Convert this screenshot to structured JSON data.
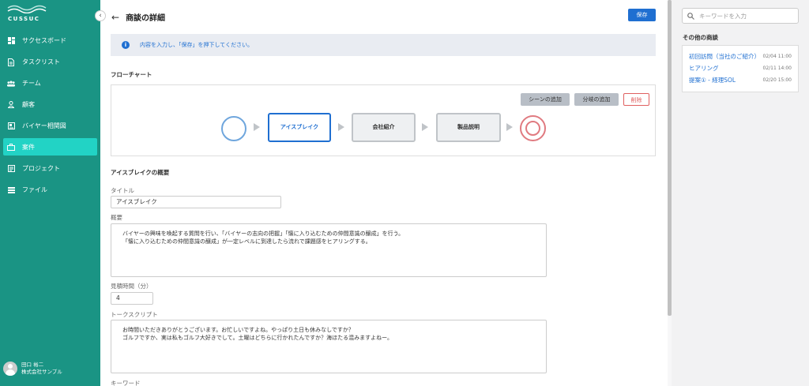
{
  "app": {
    "logo_text": "CUSSUC"
  },
  "sidebar": {
    "items": [
      {
        "label": "サクセスボード",
        "icon": "dashboard-icon"
      },
      {
        "label": "タスクリスト",
        "icon": "document-icon"
      },
      {
        "label": "チーム",
        "icon": "team-icon"
      },
      {
        "label": "顧客",
        "icon": "person-icon"
      },
      {
        "label": "バイヤー相関図",
        "icon": "id-card-icon"
      },
      {
        "label": "案件",
        "icon": "briefcase-icon",
        "active": true
      },
      {
        "label": "プロジェクト",
        "icon": "project-icon"
      },
      {
        "label": "ファイル",
        "icon": "list-icon"
      }
    ],
    "user": {
      "name": "田口 裕二",
      "company": "株式会社サンプル"
    }
  },
  "header": {
    "title": "商談の詳細",
    "save_label": "保存"
  },
  "info": {
    "text": "内容を入力し、「保存」を押下してください。"
  },
  "flowchart": {
    "section_title": "フローチャート",
    "buttons": {
      "add_scene": "シーンの追加",
      "add_branch": "分岐の追加",
      "delete": "削除"
    },
    "nodes": [
      "アイスブレイク",
      "会社紹介",
      "製品説明"
    ],
    "active_node": "アイスブレイク"
  },
  "detail": {
    "section_title": "アイスブレイクの概要",
    "title_label": "タイトル",
    "title_value": "アイスブレイク",
    "summary_label": "概要",
    "summary_value": "バイヤーの興味を喚起する質問を行い、「バイヤーの志向の把握」「懐に入り込むための仲間意識の醸成」を行う。\n「懐に入り込むための仲間意識の醸成」が一定レベルに到達したら流れで課題感をヒアリングする。",
    "time_label": "見積時間（分）",
    "time_value": "4",
    "script_label": "トークスクリプト",
    "script_value": "お時間いただきありがとうございます。お忙しいですよね。やっぱり土日も休みなしですか？\nゴルフですか、実は私もゴルフ大好きでして。土曜はどちらに行かれたんですか？海ほたる混みますよねー。",
    "keyword_label": "キーワード"
  },
  "right_panel": {
    "search_placeholder": "キーワードを入力",
    "other_title": "その他の商談",
    "others": [
      {
        "name": "初回訪問（当社のご紹介）",
        "time": "02/04 11:00"
      },
      {
        "name": "ヒアリング",
        "time": "02/11 14:00"
      },
      {
        "name": "提案① - 経理SOL",
        "time": "02/20 15:00"
      }
    ]
  }
}
